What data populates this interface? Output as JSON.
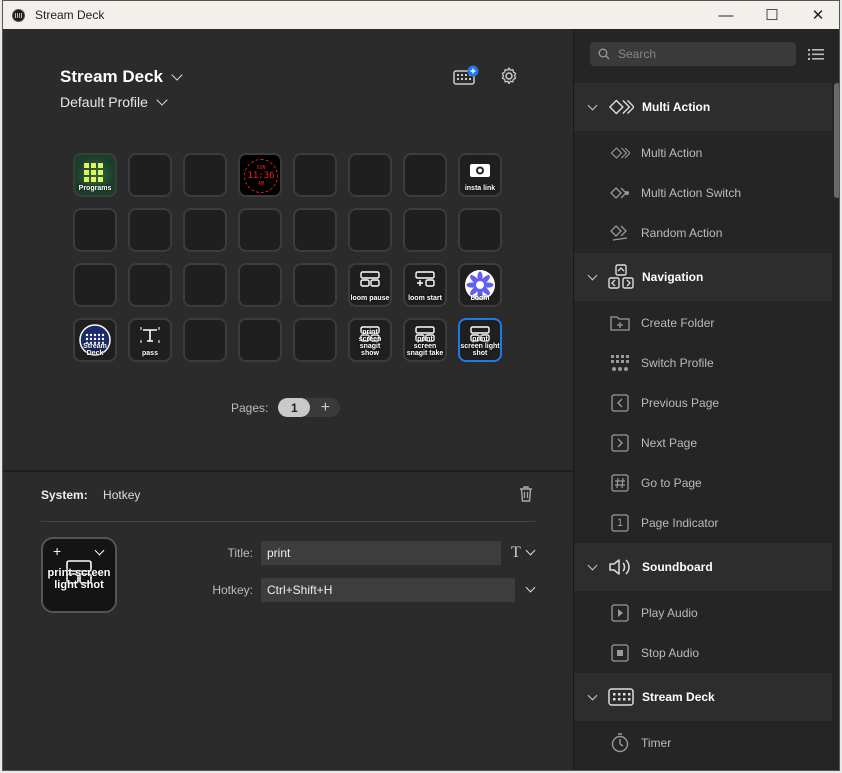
{
  "window": {
    "title": "Stream Deck",
    "minimize_glyph": "—",
    "maximize_glyph": "☐",
    "close_glyph": "✕"
  },
  "device": {
    "name": "Stream Deck",
    "profile": "Default Profile"
  },
  "keys": [
    {
      "label": "Programs",
      "icon": "apps-grid-icon",
      "bg": "#2f6b3f"
    },
    {
      "label": ""
    },
    {
      "label": ""
    },
    {
      "label": "",
      "icon": "clock-icon",
      "clock_lines": [
        "SUN",
        "11:36",
        "AM"
      ]
    },
    {
      "label": ""
    },
    {
      "label": ""
    },
    {
      "label": ""
    },
    {
      "label": "insta link",
      "icon": "camera-icon"
    },
    {
      "label": ""
    },
    {
      "label": ""
    },
    {
      "label": ""
    },
    {
      "label": ""
    },
    {
      "label": ""
    },
    {
      "label": ""
    },
    {
      "label": ""
    },
    {
      "label": ""
    },
    {
      "label": ""
    },
    {
      "label": ""
    },
    {
      "label": ""
    },
    {
      "label": ""
    },
    {
      "label": ""
    },
    {
      "label": "loom pause",
      "icon": "hotkey-icon"
    },
    {
      "label": "loom start",
      "icon": "hotkey-add-icon"
    },
    {
      "label": "Loom",
      "icon": "loom-icon"
    },
    {
      "label": "Stream Deck",
      "icon": "streamdeck-icon"
    },
    {
      "label": "pass",
      "icon": "text-icon"
    },
    {
      "label": ""
    },
    {
      "label": ""
    },
    {
      "label": ""
    },
    {
      "label": "print screen snagit show",
      "icon": "hotkey-icon"
    },
    {
      "label": "print screen snagit take",
      "icon": "hotkey-icon"
    },
    {
      "label": "print screen light shot",
      "icon": "hotkey-icon",
      "selected": true
    }
  ],
  "pages": {
    "label": "Pages:",
    "current": "1",
    "add": "+"
  },
  "inspector": {
    "system_label": "System:",
    "action_name": "Hotkey",
    "preview_text": "print screen light shot",
    "title_label": "Title:",
    "title_value": "print",
    "hotkey_label": "Hotkey:",
    "hotkey_value": "Ctrl+Shift+H"
  },
  "search": {
    "placeholder": "Search"
  },
  "categories": [
    {
      "name": "Multi Action",
      "icon": "multi-action-icon",
      "actions": [
        {
          "name": "Multi Action",
          "icon": "multi-action-icon"
        },
        {
          "name": "Multi Action Switch",
          "icon": "multi-action-switch-icon"
        },
        {
          "name": "Random Action",
          "icon": "random-action-icon"
        }
      ]
    },
    {
      "name": "Navigation",
      "icon": "navigation-icon",
      "actions": [
        {
          "name": "Create Folder",
          "icon": "create-folder-icon"
        },
        {
          "name": "Switch Profile",
          "icon": "switch-profile-icon"
        },
        {
          "name": "Previous Page",
          "icon": "previous-page-icon"
        },
        {
          "name": "Next Page",
          "icon": "next-page-icon"
        },
        {
          "name": "Go to Page",
          "icon": "go-to-page-icon"
        },
        {
          "name": "Page Indicator",
          "icon": "page-indicator-icon",
          "glyph": "1"
        }
      ]
    },
    {
      "name": "Soundboard",
      "icon": "speaker-icon",
      "actions": [
        {
          "name": "Play Audio",
          "icon": "play-audio-icon"
        },
        {
          "name": "Stop Audio",
          "icon": "stop-audio-icon"
        }
      ]
    },
    {
      "name": "Stream Deck",
      "icon": "streamdeck-keys-icon",
      "actions": [
        {
          "name": "Timer",
          "icon": "timer-icon"
        }
      ]
    }
  ],
  "colors": {
    "accent": "#1f7ae6",
    "panel": "#2b2b2b",
    "sidebar": "#252525",
    "category_bg": "#2d2d2d"
  }
}
